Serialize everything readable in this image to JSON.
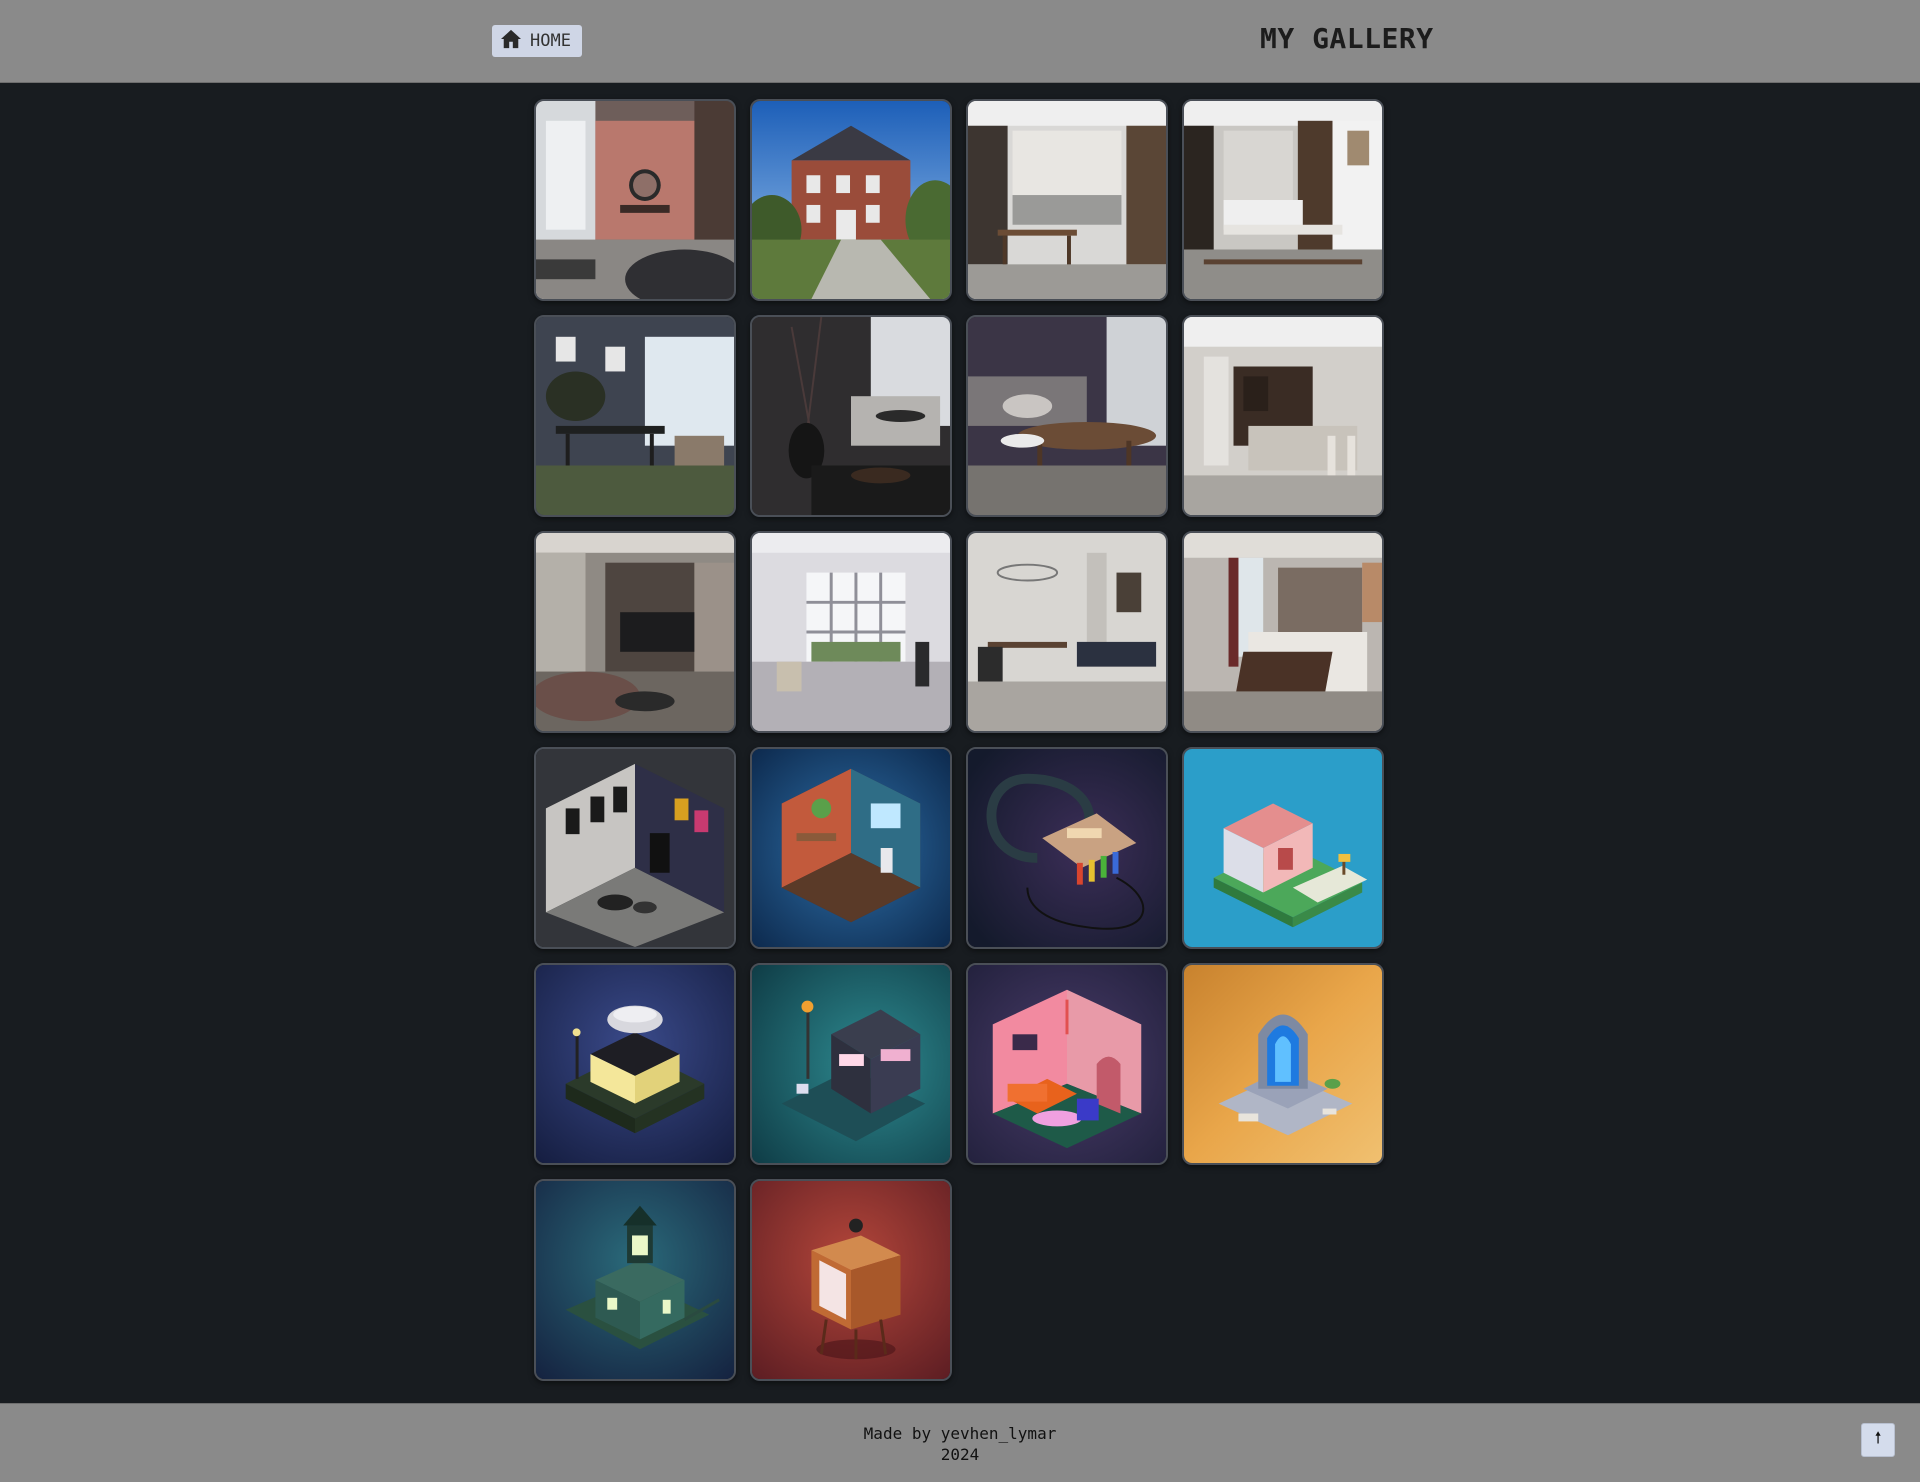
{
  "header": {
    "home_label": "HOME",
    "home_icon": "home-icon",
    "title": "MY GALLERY"
  },
  "gallery": {
    "images": [
      {
        "subject": "pink-bedroom-render"
      },
      {
        "subject": "brick-house-exterior"
      },
      {
        "subject": "marble-kitchen-dining"
      },
      {
        "subject": "dark-wood-kitchen"
      },
      {
        "subject": "grey-dining-room"
      },
      {
        "subject": "dark-vase-living-room"
      },
      {
        "subject": "purple-living-room"
      },
      {
        "subject": "modern-kitchen-island"
      },
      {
        "subject": "tv-wall-living-room"
      },
      {
        "subject": "white-window-lounge"
      },
      {
        "subject": "open-plan-living-dining"
      },
      {
        "subject": "hotel-style-bedroom"
      },
      {
        "subject": "isometric-music-studio"
      },
      {
        "subject": "isometric-teen-room"
      },
      {
        "subject": "isometric-drum-machine"
      },
      {
        "subject": "isometric-pink-cottage"
      },
      {
        "subject": "isometric-coffee-shop"
      },
      {
        "subject": "isometric-cyber-building"
      },
      {
        "subject": "isometric-pink-room"
      },
      {
        "subject": "isometric-stone-portal"
      },
      {
        "subject": "isometric-lighthouse"
      },
      {
        "subject": "isometric-retro-tv"
      }
    ]
  },
  "footer": {
    "credit_line1": "Made by yevhen_lymar",
    "credit_line2": "2024",
    "top_icon": "arrow-up-icon",
    "top_symbol": "🠕"
  },
  "colors": {
    "background": "#181c20",
    "bar": "#8a8a8a",
    "button": "#cfd6e6"
  }
}
